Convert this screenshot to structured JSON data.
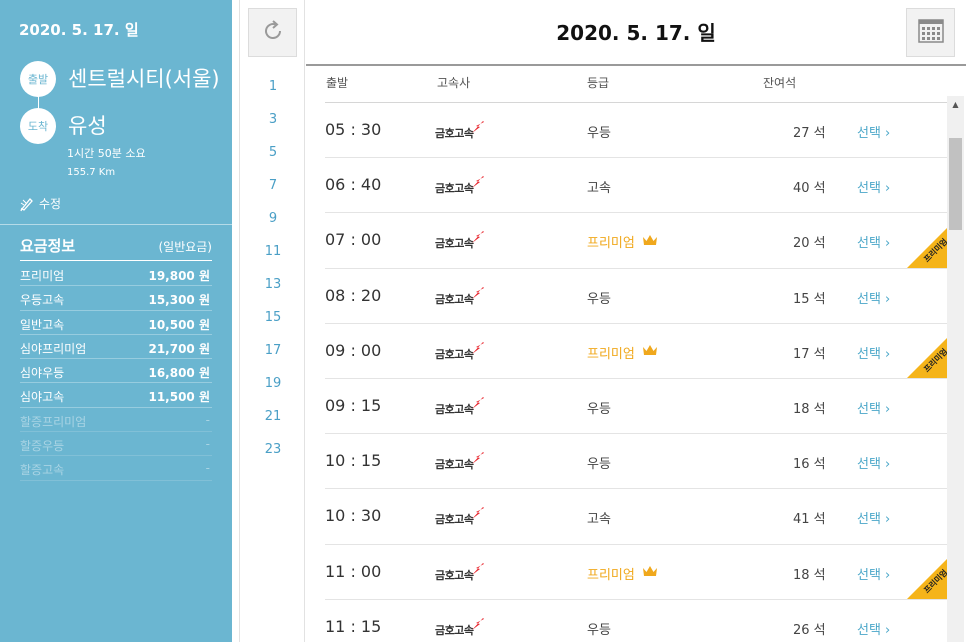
{
  "sidebar": {
    "date": "2020. 5. 17. 일",
    "departure": {
      "badge": "출발",
      "name": "센트럴시티(서울)"
    },
    "arrival": {
      "badge": "도착",
      "name": "유성"
    },
    "duration": "1시간 50분 소요",
    "distance": "155.7 Km",
    "edit_label": "수정",
    "fare": {
      "title": "요금정보",
      "subtitle": "(일반요금)",
      "items": [
        {
          "name": "프리미엄",
          "price": "19,800 원",
          "dim": false
        },
        {
          "name": "우등고속",
          "price": "15,300 원",
          "dim": false
        },
        {
          "name": "일반고속",
          "price": "10,500 원",
          "dim": false
        },
        {
          "name": "심야프리미엄",
          "price": "21,700 원",
          "dim": false
        },
        {
          "name": "심야우등",
          "price": "16,800 원",
          "dim": false
        },
        {
          "name": "심야고속",
          "price": "11,500 원",
          "dim": false
        },
        {
          "name": "할증프리미엄",
          "price": "-",
          "dim": true
        },
        {
          "name": "할증우등",
          "price": "-",
          "dim": true
        },
        {
          "name": "할증고속",
          "price": "-",
          "dim": true
        }
      ]
    }
  },
  "hours": [
    "1",
    "3",
    "5",
    "7",
    "9",
    "11",
    "13",
    "15",
    "17",
    "19",
    "21",
    "23"
  ],
  "main": {
    "title": "2020. 5. 17. 일",
    "columns": {
      "departure": "출발",
      "company": "고속사",
      "grade": "등급",
      "seats": "잔여석"
    },
    "rows": [
      {
        "time": "05 : 30",
        "company": "금호고속",
        "grade": "우등",
        "premium": false,
        "seats": "27 석",
        "select": "선택"
      },
      {
        "time": "06 : 40",
        "company": "금호고속",
        "grade": "고속",
        "premium": false,
        "seats": "40 석",
        "select": "선택"
      },
      {
        "time": "07 : 00",
        "company": "금호고속",
        "grade": "프리미엄",
        "premium": true,
        "seats": "20 석",
        "select": "선택"
      },
      {
        "time": "08 : 20",
        "company": "금호고속",
        "grade": "우등",
        "premium": false,
        "seats": "15 석",
        "select": "선택"
      },
      {
        "time": "09 : 00",
        "company": "금호고속",
        "grade": "프리미엄",
        "premium": true,
        "seats": "17 석",
        "select": "선택"
      },
      {
        "time": "09 : 15",
        "company": "금호고속",
        "grade": "우등",
        "premium": false,
        "seats": "18 석",
        "select": "선택"
      },
      {
        "time": "10 : 15",
        "company": "금호고속",
        "grade": "우등",
        "premium": false,
        "seats": "16 석",
        "select": "선택"
      },
      {
        "time": "10 : 30",
        "company": "금호고속",
        "grade": "고속",
        "premium": false,
        "seats": "41 석",
        "select": "선택"
      },
      {
        "time": "11 : 00",
        "company": "금호고속",
        "grade": "프리미엄",
        "premium": true,
        "seats": "18 석",
        "select": "선택"
      },
      {
        "time": "11 : 15",
        "company": "금호고속",
        "grade": "우등",
        "premium": false,
        "seats": "26 석",
        "select": "선택"
      }
    ],
    "premium_ribbon": "프리미엄"
  },
  "icons": {
    "refresh": "refresh-icon",
    "calendar": "calendar-icon",
    "edit": "pencil-icon",
    "crown": "crown-icon",
    "chevron": "chevron-right-icon"
  },
  "colors": {
    "sidebar": "#6bb6d1",
    "accent": "#4ba7c9",
    "premium": "#f0a81c",
    "brand_mark": "#e8262e"
  }
}
